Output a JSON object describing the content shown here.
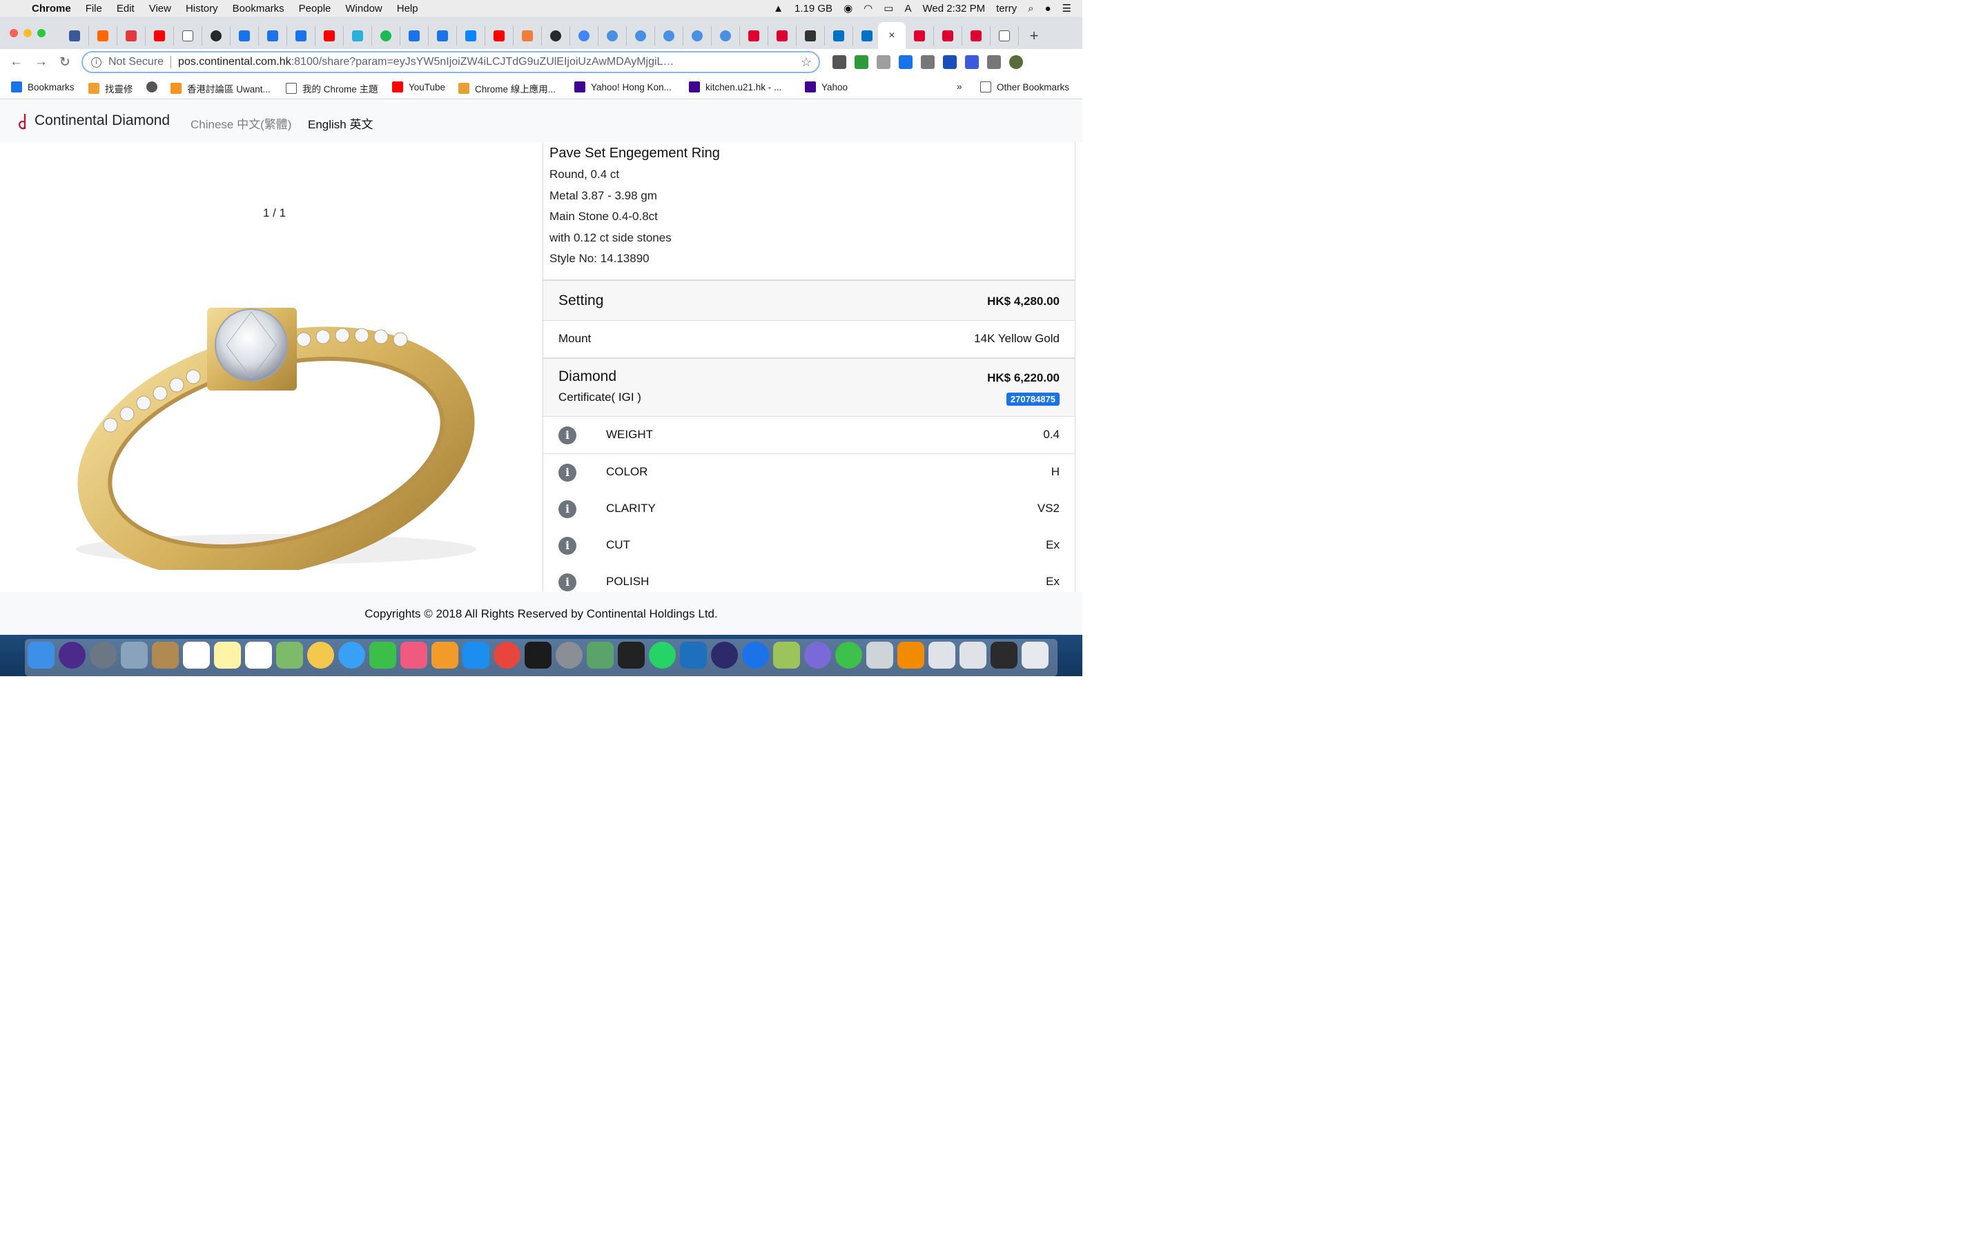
{
  "menubar": {
    "app": "Chrome",
    "items": [
      "File",
      "Edit",
      "View",
      "History",
      "Bookmarks",
      "People",
      "Window",
      "Help"
    ],
    "memory": "1.19 GB",
    "clock": "Wed 2:32 PM",
    "user": "terry",
    "input_source": "A"
  },
  "tabs": {
    "active_close": "×",
    "new_tab": "+"
  },
  "toolbar": {
    "security_label": "Not Secure",
    "url_host": "pos.continental.com.hk",
    "url_path": ":8100/share?param=eyJsYW5nIjoiZW4iLCJTdG9uZUlEIjoiUzAwMDAyMjgiLCJNZXRhbCI6IjE0SyBZZW..."
  },
  "bookmarks": {
    "items": [
      "Bookmarks",
      "找靈修",
      "香港討論區 Uwant...",
      "我的 Chrome 主題",
      "YouTube",
      "Chrome 線上應用...",
      "Yahoo! Hong Kon...",
      "kitchen.u21.hk - ...",
      "Yahoo"
    ],
    "overflow": "»",
    "other": "Other Bookmarks"
  },
  "site": {
    "brand": "Continental Diamond",
    "lang_chinese": "Chinese 中文(繁體)",
    "lang_english": "English 英文"
  },
  "gallery": {
    "counter": "1 / 1"
  },
  "product": {
    "title": "Pave Set Engegement Ring",
    "lines": [
      "Round, 0.4 ct",
      "Metal 3.87 - 3.98 gm",
      "Main Stone 0.4-0.8ct",
      "with 0.12 ct side stones",
      "Style No:  14.13890"
    ]
  },
  "setting": {
    "label": "Setting",
    "price": "HK$ 4,280.00",
    "mount_label": "Mount",
    "mount_value": "14K Yellow Gold"
  },
  "diamond": {
    "label": "Diamond",
    "price": "HK$ 6,220.00",
    "certificate": "Certificate( IGI )",
    "cert_number": "270784875",
    "specs": [
      {
        "label": "WEIGHT",
        "value": "0.4"
      },
      {
        "label": "COLOR",
        "value": "H"
      },
      {
        "label": "CLARITY",
        "value": "VS2"
      },
      {
        "label": "CUT",
        "value": "Ex"
      },
      {
        "label": "POLISH",
        "value": "Ex"
      }
    ]
  },
  "footer": {
    "text": "Copyrights © 2018 All Rights Reserved by Continental Holdings Ltd."
  },
  "colors": {
    "badge": "#1a73e8",
    "info_icon": "#6c757d",
    "gold": "#d6b25e"
  }
}
